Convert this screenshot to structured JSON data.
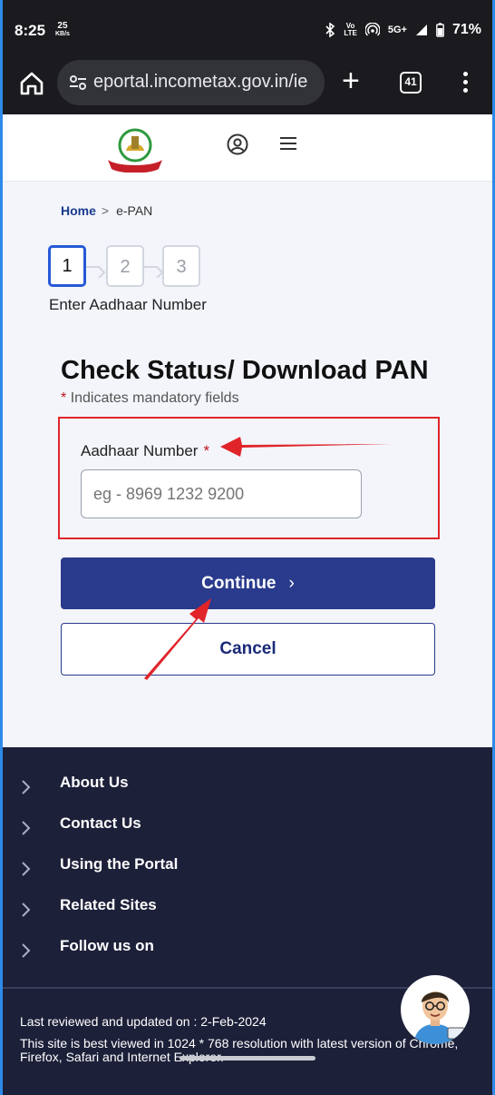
{
  "status_bar": {
    "time": "8:25",
    "speed_value": "25",
    "speed_unit": "KB/s",
    "network": "5G+",
    "battery": "71%"
  },
  "browser": {
    "url": "eportal.incometax.gov.in/ie",
    "tab_count": "41"
  },
  "breadcrumb": {
    "home": "Home",
    "current": "e-PAN"
  },
  "stepper": {
    "steps": [
      "1",
      "2",
      "3"
    ],
    "active_label": "Enter Aadhaar Number"
  },
  "form": {
    "title": "Check Status/ Download PAN",
    "mandatory_asterisk": "*",
    "mandatory_note": "Indicates mandatory fields",
    "aadhaar_label": "Aadhaar Number",
    "aadhaar_placeholder": "eg - 8969 1232 9200",
    "continue_label": "Continue",
    "cancel_label": "Cancel"
  },
  "footer": {
    "links": [
      "About Us",
      "Contact Us",
      "Using the Portal",
      "Related Sites",
      "Follow us on"
    ],
    "reviewed": "Last reviewed and updated on : 2-Feb-2024",
    "best_viewed": "This site is best viewed in 1024 * 768 resolution with latest version of Chrome, Firefox, Safari and Internet Explorer."
  },
  "colors": {
    "primary": "#2a3a8c",
    "annotation": "#e0242a",
    "footer_bg": "#1d2039"
  }
}
